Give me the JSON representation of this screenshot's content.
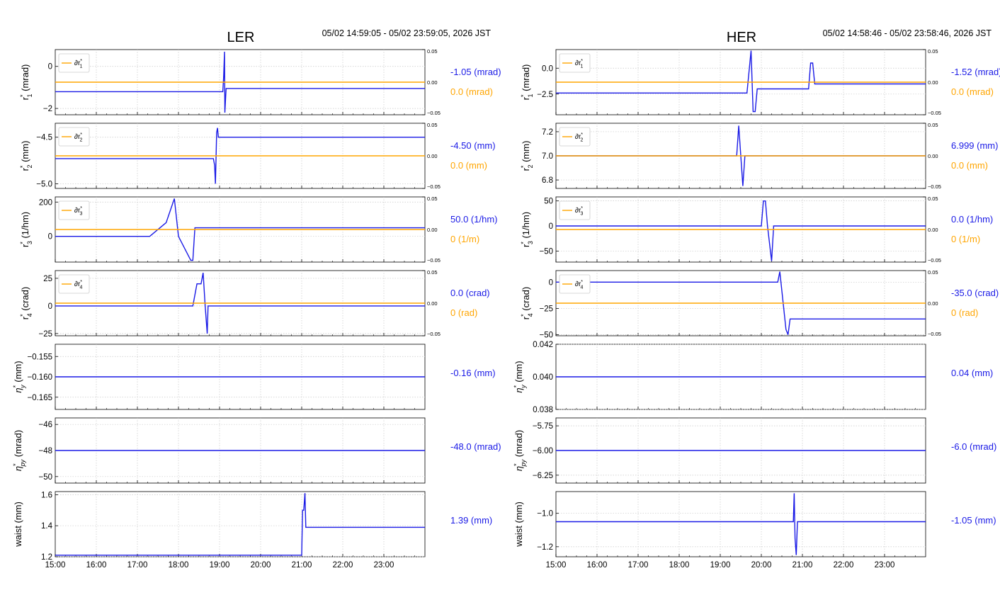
{
  "colors": {
    "blue": "#1a1ae6",
    "orange": "#ffa500",
    "grid": "#c8c8c8",
    "axis": "#000000"
  },
  "x_ticks": [
    "15:00",
    "16:00",
    "17:00",
    "18:00",
    "19:00",
    "20:00",
    "21:00",
    "22:00",
    "23:00"
  ],
  "time_range": [
    15.0,
    24.0
  ],
  "panels_meta": [
    {
      "title": "LER",
      "datetime": "05/02 14:59:05 - 05/02 23:59:05, 2026 JST"
    },
    {
      "title": "HER",
      "datetime": "05/02 14:58:46 - 05/02 23:58:46, 2026 JST"
    }
  ],
  "chart_data": [
    {
      "type": "line",
      "panel": "LER",
      "row": 1,
      "ylabel": "r*1 (mrad)",
      "yticks": [
        "0",
        "−2"
      ],
      "ytick_values": [
        0,
        -2
      ],
      "ylim": [
        -2.3,
        0.8
      ],
      "right_ticks": [
        "0.05",
        "0.00",
        "−0.05"
      ],
      "right_ylim": [
        -0.05,
        0.05
      ],
      "legend": "∂r*1",
      "series": [
        {
          "name": "r*1",
          "color": "blue",
          "x": [
            15.0,
            19.08,
            19.1,
            19.12,
            19.13,
            19.15,
            19.16,
            19.18,
            24.0
          ],
          "y": [
            -1.2,
            -1.2,
            -0.5,
            0.7,
            -2.2,
            -1.4,
            -1.05,
            -1.05,
            -1.05
          ]
        },
        {
          "name": "∂r*1",
          "color": "orange",
          "axis": "right",
          "x": [
            15.0,
            24.0
          ],
          "y": [
            0.0,
            0.0
          ]
        }
      ],
      "value_blue": "-1.05 (mrad)",
      "value_orange": "0.0 (mrad)"
    },
    {
      "type": "line",
      "panel": "LER",
      "row": 2,
      "ylabel": "r*2 (mm)",
      "yticks": [
        "−4.5",
        "−5.0"
      ],
      "ytick_values": [
        -4.5,
        -5.0
      ],
      "ylim": [
        -5.05,
        -4.35
      ],
      "right_ticks": [
        "0.05",
        "0.00",
        "−0.05"
      ],
      "right_ylim": [
        -0.05,
        0.05
      ],
      "legend": "∂r*2",
      "series": [
        {
          "name": "r*2",
          "color": "blue",
          "x": [
            15.0,
            18.85,
            18.88,
            18.9,
            18.93,
            18.95,
            18.97,
            19.0,
            24.0
          ],
          "y": [
            -4.73,
            -4.73,
            -4.8,
            -5.0,
            -4.45,
            -4.4,
            -4.5,
            -4.5,
            -4.5
          ]
        },
        {
          "name": "∂r*2",
          "color": "orange",
          "axis": "right",
          "x": [
            15.0,
            24.0
          ],
          "y": [
            0.0,
            0.0
          ]
        }
      ],
      "value_blue": "-4.50 (mm)",
      "value_orange": "0.0 (mm)"
    },
    {
      "type": "line",
      "panel": "LER",
      "row": 3,
      "ylabel": "r*3 (1/hm)",
      "yticks": [
        "200",
        "0"
      ],
      "ytick_values": [
        200,
        0
      ],
      "ylim": [
        -150,
        230
      ],
      "right_ticks": [
        "0.05",
        "0.00",
        "−0.05"
      ],
      "right_ylim": [
        -0.05,
        0.05
      ],
      "legend": "∂r*3",
      "series": [
        {
          "name": "r*3",
          "color": "blue",
          "x": [
            15.0,
            17.3,
            17.7,
            17.9,
            18.0,
            18.3,
            18.35,
            18.4,
            24.0
          ],
          "y": [
            0,
            0,
            80,
            220,
            0,
            -140,
            -140,
            50,
            50
          ]
        },
        {
          "name": "∂r*3",
          "color": "orange",
          "axis": "right",
          "x": [
            15.0,
            24.0
          ],
          "y": [
            0.0,
            0.0
          ]
        }
      ],
      "value_blue": "50.0 (1/hm)",
      "value_orange": "0 (1/m)"
    },
    {
      "type": "line",
      "panel": "LER",
      "row": 4,
      "ylabel": "r*4 (crad)",
      "yticks": [
        "25",
        "0",
        "−25"
      ],
      "ytick_values": [
        25,
        0,
        -25
      ],
      "ylim": [
        -27,
        32
      ],
      "right_ticks": [
        "0.05",
        "0.00",
        "−0.05"
      ],
      "right_ylim": [
        -0.05,
        0.05
      ],
      "legend": "∂r*4",
      "series": [
        {
          "name": "r*4",
          "color": "blue",
          "x": [
            15.0,
            18.35,
            18.45,
            18.55,
            18.6,
            18.65,
            18.7,
            18.72,
            24.0
          ],
          "y": [
            0,
            0,
            20,
            20,
            30,
            0,
            -25,
            0,
            0
          ]
        },
        {
          "name": "∂r*4",
          "color": "orange",
          "axis": "right",
          "x": [
            15.0,
            24.0
          ],
          "y": [
            0.0,
            0.0
          ]
        }
      ],
      "value_blue": "0.0 (crad)",
      "value_orange": "0 (rad)"
    },
    {
      "type": "line",
      "panel": "LER",
      "row": 5,
      "ylabel": "η*y (mm)",
      "yticks": [
        "−0.155",
        "−0.160",
        "−0.165"
      ],
      "ytick_values": [
        -0.155,
        -0.16,
        -0.165
      ],
      "ylim": [
        -0.168,
        -0.152
      ],
      "series": [
        {
          "name": "η*y",
          "color": "blue",
          "x": [
            15.0,
            24.0
          ],
          "y": [
            -0.16,
            -0.16
          ]
        }
      ],
      "value_blue": "-0.16 (mm)"
    },
    {
      "type": "line",
      "panel": "LER",
      "row": 6,
      "ylabel": "η*py (mrad)",
      "yticks": [
        "−46",
        "−48",
        "−50"
      ],
      "ytick_values": [
        -46,
        -48,
        -50
      ],
      "ylim": [
        -50.5,
        -45.5
      ],
      "series": [
        {
          "name": "η*py",
          "color": "blue",
          "x": [
            15.0,
            24.0
          ],
          "y": [
            -48.0,
            -48.0
          ]
        }
      ],
      "value_blue": "-48.0 (mrad)"
    },
    {
      "type": "line",
      "panel": "LER",
      "row": 7,
      "ylabel": "waist (mm)",
      "yticks": [
        "1.6",
        "1.4",
        "1.2"
      ],
      "ytick_values": [
        1.6,
        1.4,
        1.2
      ],
      "ylim": [
        1.2,
        1.62
      ],
      "series": [
        {
          "name": "waist",
          "color": "blue",
          "x": [
            15.0,
            21.0,
            21.02,
            21.05,
            21.08,
            21.1,
            24.0
          ],
          "y": [
            1.21,
            1.21,
            1.5,
            1.5,
            1.61,
            1.39,
            1.39
          ]
        }
      ],
      "value_blue": "1.39 (mm)"
    },
    {
      "type": "line",
      "panel": "HER",
      "row": 1,
      "ylabel": "r*1 (mrad)",
      "yticks": [
        "0.0",
        "−2.5"
      ],
      "ytick_values": [
        0.0,
        -2.5
      ],
      "ylim": [
        -4.5,
        1.8
      ],
      "right_ticks": [
        "0.05",
        "0.00",
        "−0.05"
      ],
      "right_ylim": [
        -0.05,
        0.05
      ],
      "legend": "∂r*1",
      "series": [
        {
          "name": "r*1",
          "color": "blue",
          "x": [
            15.0,
            19.65,
            19.75,
            19.8,
            19.85,
            19.9,
            19.95,
            21.15,
            21.2,
            21.25,
            21.3,
            24.0
          ],
          "y": [
            -2.4,
            -2.4,
            1.7,
            -4.2,
            -4.2,
            -2.0,
            -2.0,
            -2.0,
            0.5,
            0.5,
            -1.52,
            -1.52
          ]
        },
        {
          "name": "∂r*1",
          "color": "orange",
          "axis": "right",
          "x": [
            15.0,
            24.0
          ],
          "y": [
            0.0,
            0.0
          ]
        }
      ],
      "value_blue": "-1.52 (mrad)",
      "value_orange": "0.0 (mrad)"
    },
    {
      "type": "line",
      "panel": "HER",
      "row": 2,
      "ylabel": "r*2 (mm)",
      "yticks": [
        "7.2",
        "7.0",
        "6.8"
      ],
      "ytick_values": [
        7.2,
        7.0,
        6.8
      ],
      "ylim": [
        6.73,
        7.27
      ],
      "right_ticks": [
        "0.05",
        "0.00",
        "−0.05"
      ],
      "right_ylim": [
        -0.05,
        0.05
      ],
      "legend": "∂r*2",
      "series": [
        {
          "name": "r*2",
          "color": "blue",
          "x": [
            15.0,
            19.4,
            19.45,
            19.5,
            19.55,
            19.6,
            24.0
          ],
          "y": [
            7.0,
            7.0,
            7.25,
            7.0,
            6.75,
            7.0,
            7.0
          ]
        },
        {
          "name": "∂r*2",
          "color": "orange",
          "axis": "right",
          "x": [
            15.0,
            24.0
          ],
          "y": [
            0.0,
            0.0
          ]
        }
      ],
      "value_blue": "6.999 (mm)",
      "value_orange": "0.0 (mm)"
    },
    {
      "type": "line",
      "panel": "HER",
      "row": 3,
      "ylabel": "r*3 (1/hm)",
      "yticks": [
        "50",
        "0",
        "−50"
      ],
      "ytick_values": [
        50,
        0,
        -50
      ],
      "ylim": [
        -72,
        58
      ],
      "right_ticks": [
        "0.05",
        "0.00",
        "−0.05"
      ],
      "right_ylim": [
        -0.05,
        0.05
      ],
      "legend": "∂r*3",
      "series": [
        {
          "name": "r*3",
          "color": "blue",
          "x": [
            15.0,
            20.0,
            20.05,
            20.1,
            20.15,
            20.25,
            20.3,
            24.0
          ],
          "y": [
            0,
            0,
            50,
            50,
            0,
            -70,
            0,
            0
          ]
        },
        {
          "name": "∂r*3",
          "color": "orange",
          "axis": "right",
          "x": [
            15.0,
            24.0
          ],
          "y": [
            0.0,
            0.0
          ]
        }
      ],
      "value_blue": "0.0 (1/hm)",
      "value_orange": "0 (1/m)"
    },
    {
      "type": "line",
      "panel": "HER",
      "row": 4,
      "ylabel": "r*4 (crad)",
      "yticks": [
        "0",
        "−25",
        "−50"
      ],
      "ytick_values": [
        0,
        -25,
        -50
      ],
      "ylim": [
        -51,
        11
      ],
      "right_ticks": [
        "0.05",
        "0.00",
        "−0.05"
      ],
      "right_ylim": [
        -0.05,
        0.05
      ],
      "legend": "∂r*4",
      "series": [
        {
          "name": "r*4",
          "color": "blue",
          "x": [
            15.0,
            20.4,
            20.45,
            20.6,
            20.65,
            20.7,
            24.0
          ],
          "y": [
            0,
            0,
            10,
            -45,
            -50,
            -35,
            -35
          ]
        },
        {
          "name": "∂r*4",
          "color": "orange",
          "axis": "right",
          "x": [
            15.0,
            24.0
          ],
          "y": [
            0.0,
            0.0
          ]
        }
      ],
      "value_blue": "-35.0 (crad)",
      "value_orange": "0 (rad)"
    },
    {
      "type": "line",
      "panel": "HER",
      "row": 5,
      "ylabel": "η*y (mm)",
      "yticks": [
        "0.042",
        "0.040",
        "0.038"
      ],
      "ytick_values": [
        0.042,
        0.04,
        0.038
      ],
      "ylim": [
        0.038,
        0.042
      ],
      "series": [
        {
          "name": "η*y",
          "color": "blue",
          "x": [
            15.0,
            24.0
          ],
          "y": [
            0.04,
            0.04
          ]
        }
      ],
      "value_blue": "0.04 (mm)"
    },
    {
      "type": "line",
      "panel": "HER",
      "row": 6,
      "ylabel": "η*py (mrad)",
      "yticks": [
        "−5.75",
        "−6.00",
        "−6.25"
      ],
      "ytick_values": [
        -5.75,
        -6.0,
        -6.25
      ],
      "ylim": [
        -6.33,
        -5.67
      ],
      "series": [
        {
          "name": "η*py",
          "color": "blue",
          "x": [
            15.0,
            24.0
          ],
          "y": [
            -6.0,
            -6.0
          ]
        }
      ],
      "value_blue": "-6.0 (mrad)"
    },
    {
      "type": "line",
      "panel": "HER",
      "row": 7,
      "ylabel": "waist (mm)",
      "yticks": [
        "−1.0",
        "−1.2"
      ],
      "ytick_values": [
        -1.0,
        -1.2
      ],
      "ylim": [
        -1.26,
        -0.87
      ],
      "series": [
        {
          "name": "waist",
          "color": "blue",
          "x": [
            15.0,
            20.78,
            20.8,
            20.82,
            20.85,
            20.88,
            24.0
          ],
          "y": [
            -1.05,
            -1.05,
            -0.88,
            -1.15,
            -1.25,
            -1.05,
            -1.05
          ]
        }
      ],
      "value_blue": "-1.05 (mm)"
    }
  ]
}
